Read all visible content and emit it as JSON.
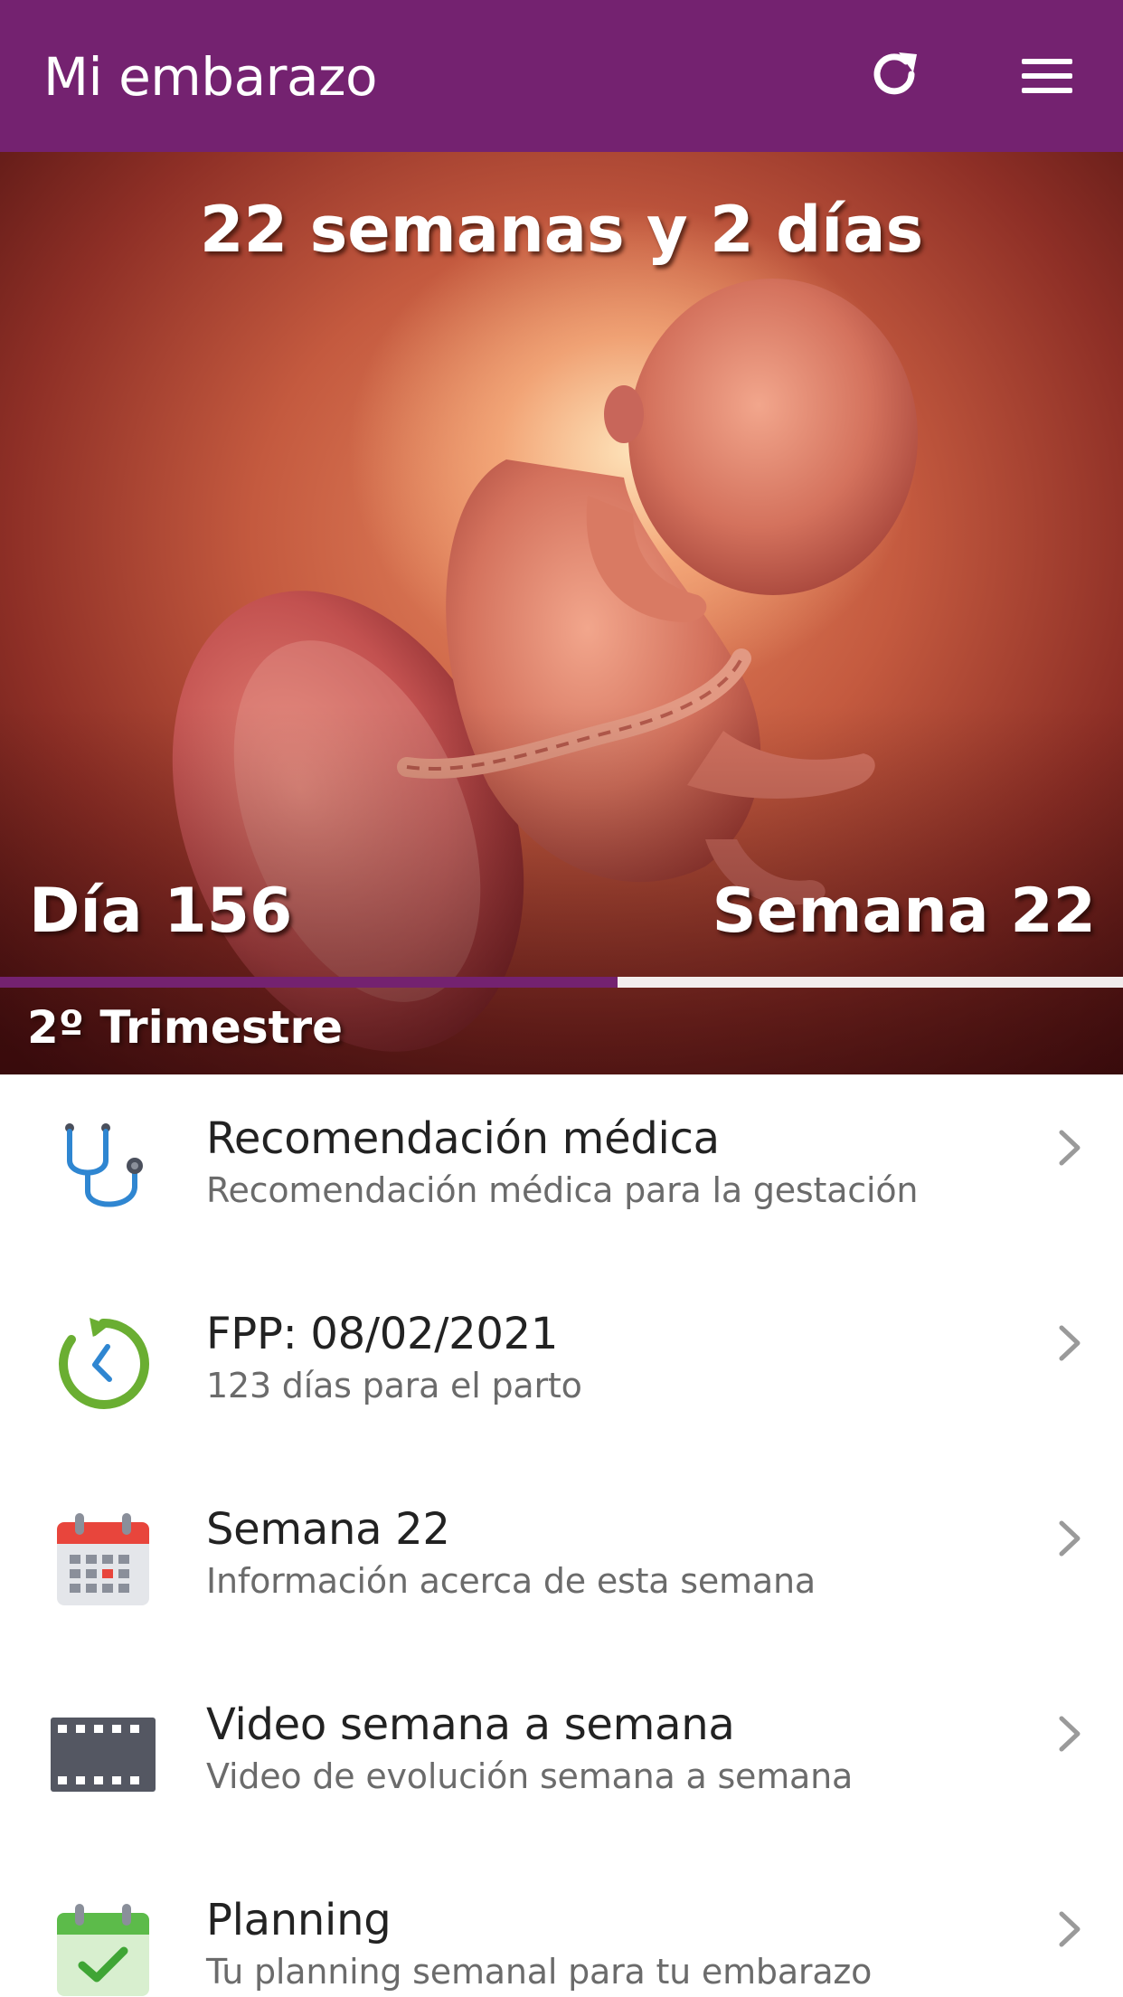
{
  "appbar": {
    "title": "Mi embarazo",
    "refresh_icon": "refresh-icon",
    "menu_icon": "hamburger-menu-icon",
    "color": "#742270"
  },
  "hero": {
    "heading": "22 semanas y 2 días",
    "day_label": "Día 156",
    "week_label": "Semana 22",
    "trimester_label": "2º Trimestre",
    "progress_fraction": 0.55,
    "image": "fetus-illustration"
  },
  "list": {
    "items": [
      {
        "title": "Recomendación médica",
        "subtitle": "Recomendación médica para la gestación",
        "icon": "stethoscope-icon"
      },
      {
        "title": "FPP: 08/02/2021",
        "subtitle": "123 días para el parto",
        "icon": "countdown-clock-icon"
      },
      {
        "title": "Semana 22",
        "subtitle": "Información acerca de esta semana",
        "icon": "calendar-icon"
      },
      {
        "title": "Video semana a semana",
        "subtitle": "Video de evolución semana a semana",
        "icon": "film-strip-icon"
      },
      {
        "title": "Planning",
        "subtitle": "Tu planning semanal para tu embarazo",
        "icon": "calendar-check-icon"
      }
    ]
  }
}
